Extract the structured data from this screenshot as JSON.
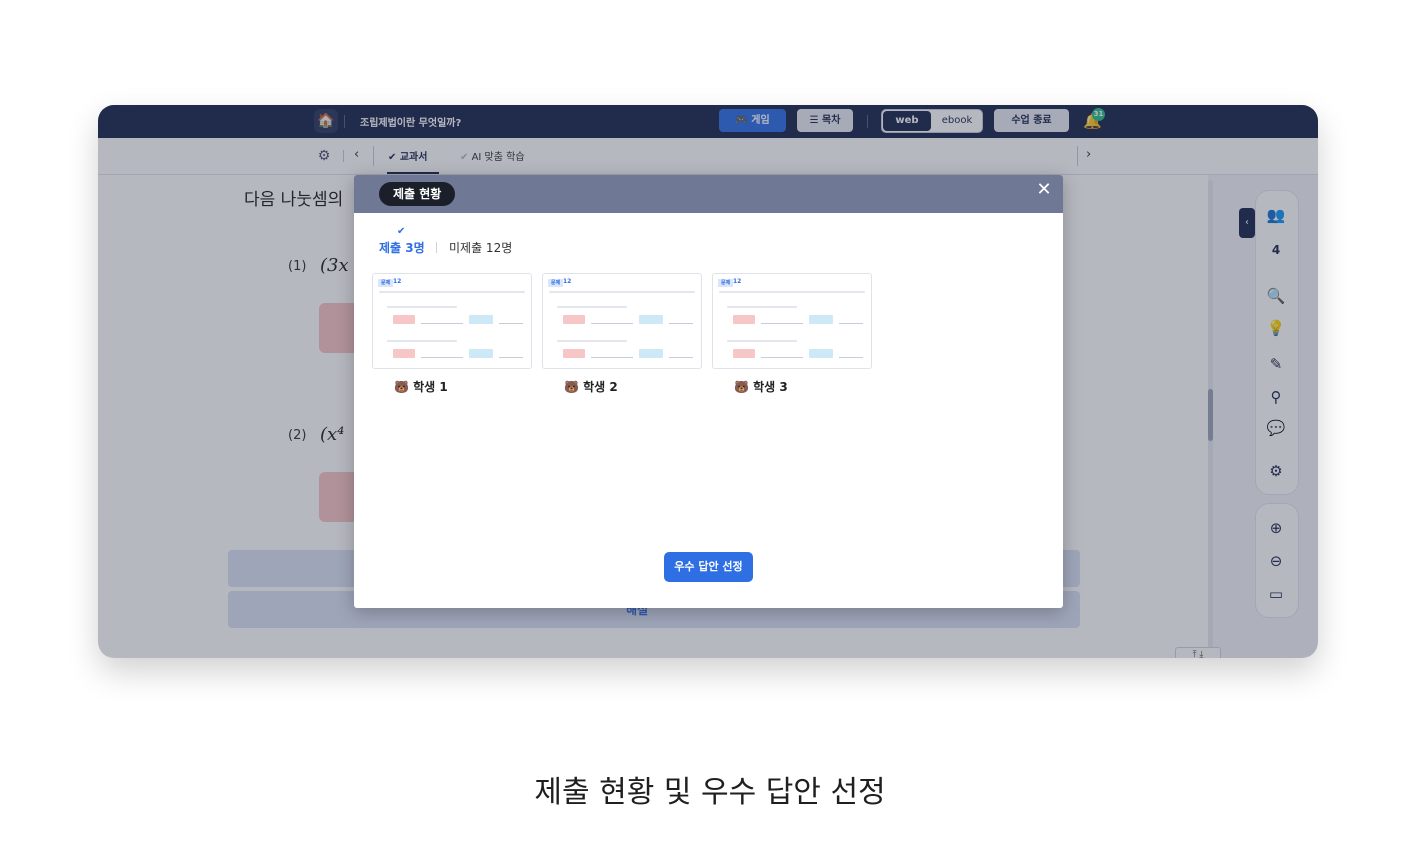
{
  "topbar": {
    "home_icon": "🏠",
    "lesson_title": "조립제법이란 무엇일까?",
    "game_label": "🎮 게임",
    "toc_label": "☰ 목차",
    "mode_web": "web",
    "mode_ebook": "ebook",
    "end_class_label": "수업 종료",
    "bell_icon": "🔔",
    "bell_badge": "31"
  },
  "subbar": {
    "gear_icon": "⚙",
    "prev_icon": "‹",
    "tab_textbook": "✔ 교과서",
    "tab_ai_check": "✔",
    "tab_ai": "AI 맞춤 학습",
    "next_icon": "›"
  },
  "content": {
    "question_text": "다음 나눗셈의",
    "q1_number": "(1)",
    "q1_expr": "(3x",
    "q2_number": "(2)",
    "q2_expr": "(x⁴",
    "bar2_label": "해설"
  },
  "scroll": {
    "buttons": "⤒ ⤓"
  },
  "sidebar": {
    "toggle_icon": "‹",
    "students_icon": "👥",
    "student_count": "4",
    "search_doc_icon": "🔍",
    "idea_icon": "💡",
    "pen_icon": "✎",
    "compass_icon": "⚲",
    "chat_icon": "💬",
    "settings_icon": "⚙",
    "zoom_in_icon": "⊕",
    "zoom_out_icon": "⊖",
    "screen_icon": "▭"
  },
  "modal": {
    "title": "제출 현황",
    "close_icon": "✕",
    "check_icon": "✔",
    "tab_submitted": "제출 3명",
    "tab_unsubmitted": "미제출 12명",
    "card_tag": "문제",
    "card_number": "12",
    "students": [
      {
        "name": "🐻 학생 1"
      },
      {
        "name": "🐻 학생 2"
      },
      {
        "name": "🐻 학생 3"
      }
    ],
    "pick_best_label": "우수 답안 선정"
  },
  "caption": "제출 현황 및 우수 답안 선정"
}
